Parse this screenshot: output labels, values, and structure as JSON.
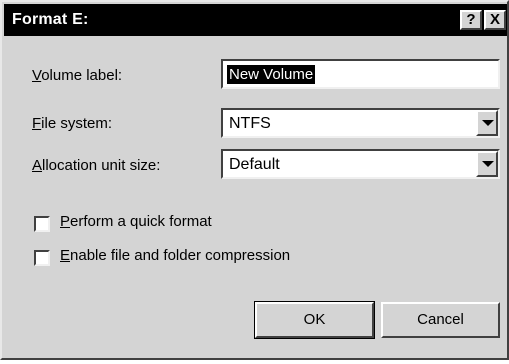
{
  "window": {
    "title": "Format E:",
    "help_button": "?",
    "close_button": "X"
  },
  "fields": {
    "volume_label": {
      "label_underlined": "V",
      "label_rest": "olume label:",
      "value": "New Volume"
    },
    "file_system": {
      "label_underlined": "F",
      "label_rest": "ile system:",
      "value": "NTFS"
    },
    "allocation_unit_size": {
      "label_underlined": "A",
      "label_rest": "llocation unit size:",
      "value": "Default"
    }
  },
  "options": {
    "quick_format": {
      "label_underlined": "P",
      "label_rest": "erform a quick format",
      "checked": false
    },
    "compression": {
      "label_underlined": "E",
      "label_rest": "nable file and folder compression",
      "checked": false
    }
  },
  "buttons": {
    "ok": "OK",
    "cancel": "Cancel"
  },
  "colors": {
    "titlebar": "#000000",
    "dialog_face": "#d4d4d4",
    "selection": "#000000"
  }
}
